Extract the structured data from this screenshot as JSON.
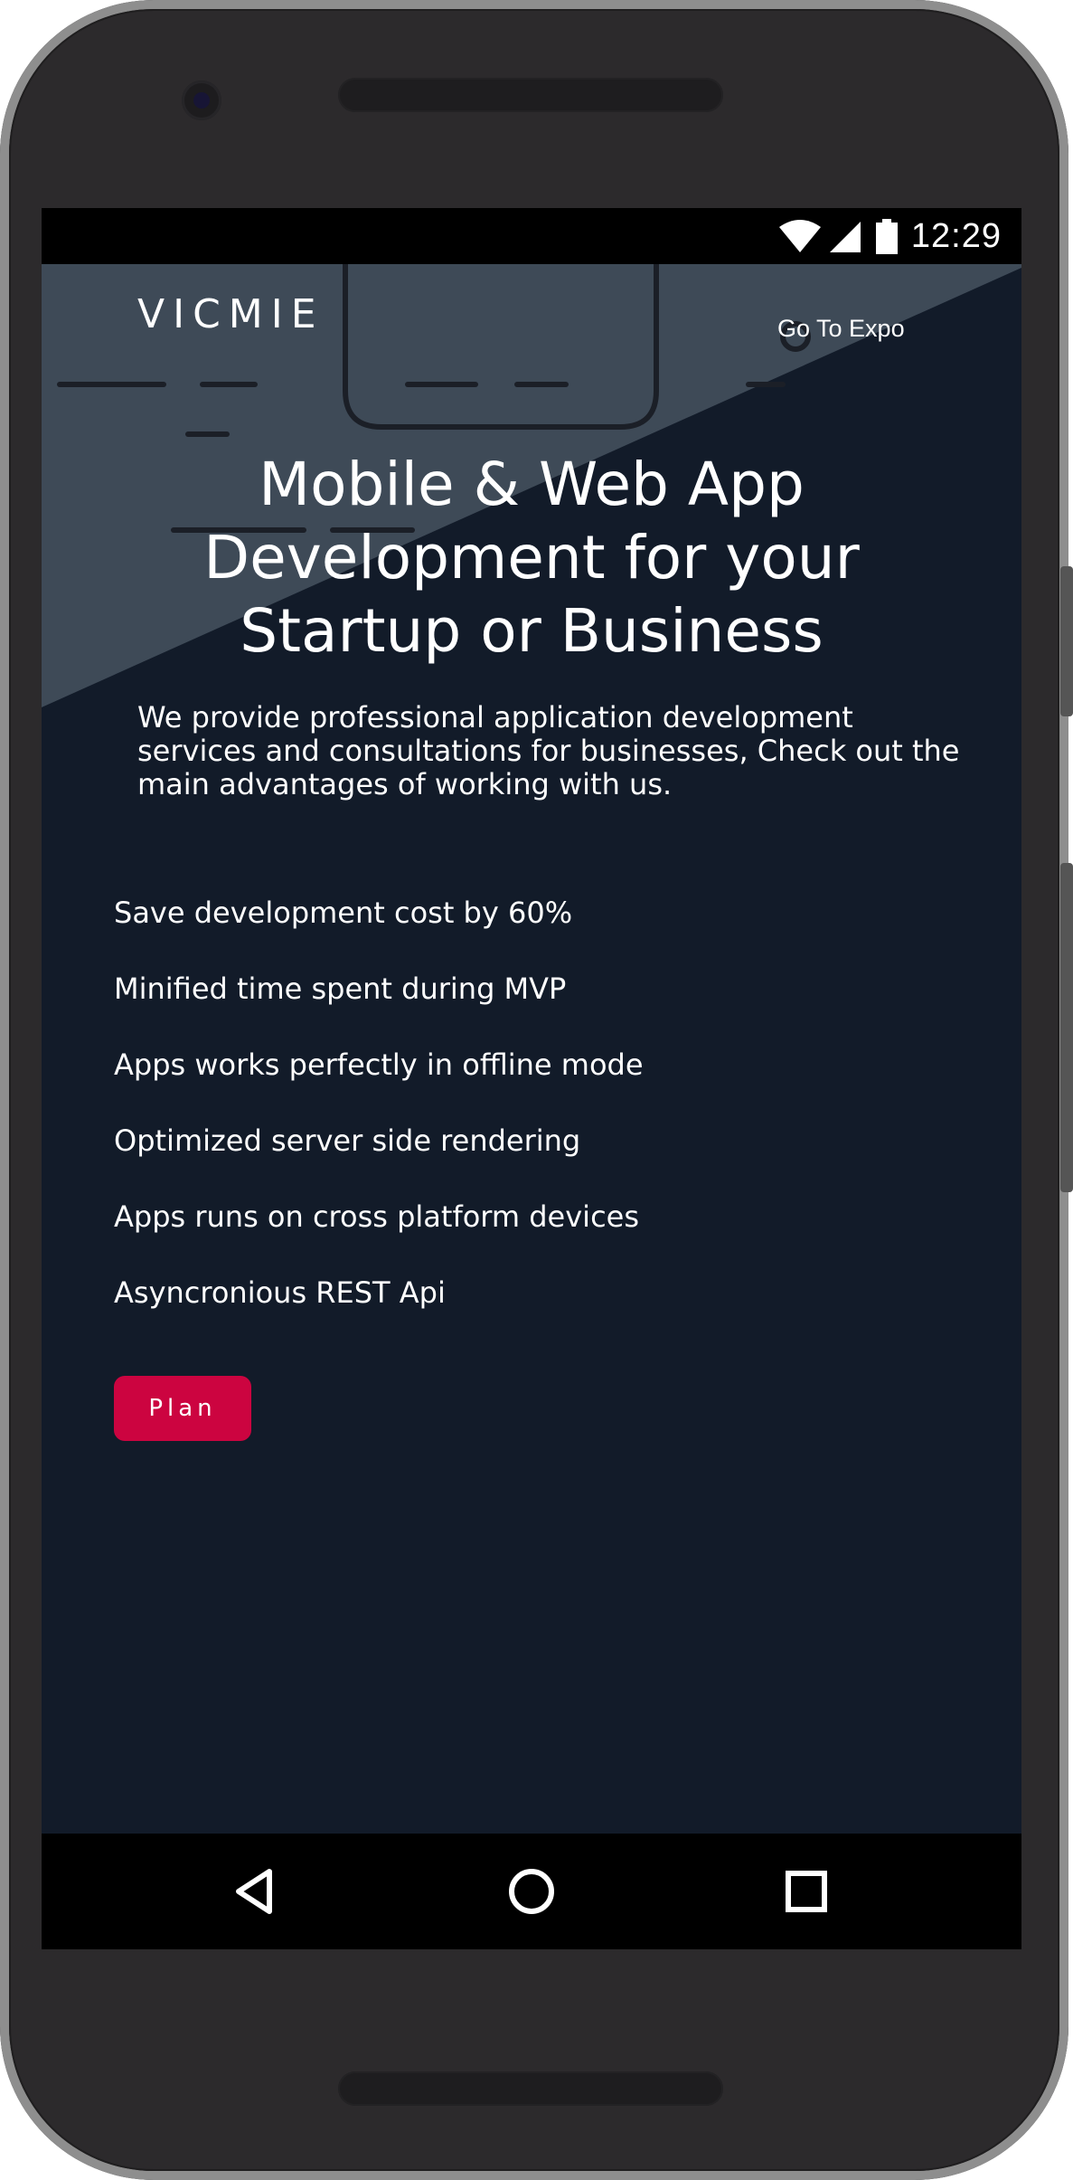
{
  "status_bar": {
    "time": "12:29",
    "icons": [
      "wifi-icon",
      "cell-signal-icon",
      "battery-icon"
    ]
  },
  "header": {
    "logo": "VICMIE",
    "expo_link": "Go To Expo"
  },
  "hero": {
    "title": "Mobile & Web App Development for your Startup or Business",
    "subtitle": "We provide professional application development services and consultations for businesses, Check out the main advantages of working with us."
  },
  "features": [
    "Save development cost by 60%",
    "Minified time spent during MVP",
    "Apps works perfectly in offline mode",
    "Optimized server side rendering",
    "Apps runs on cross platform devices",
    "Asyncronious REST Api"
  ],
  "cta": {
    "plan_label": "Plan"
  },
  "nav_bar": {
    "buttons": [
      "back-icon",
      "home-icon",
      "recent-apps-icon"
    ]
  },
  "colors": {
    "background": "#121b29",
    "diagonal_panel": "#3e4a57",
    "accent": "#cc0440",
    "device_body": "#2c2a2c",
    "device_rim": "#8e8e8e"
  }
}
